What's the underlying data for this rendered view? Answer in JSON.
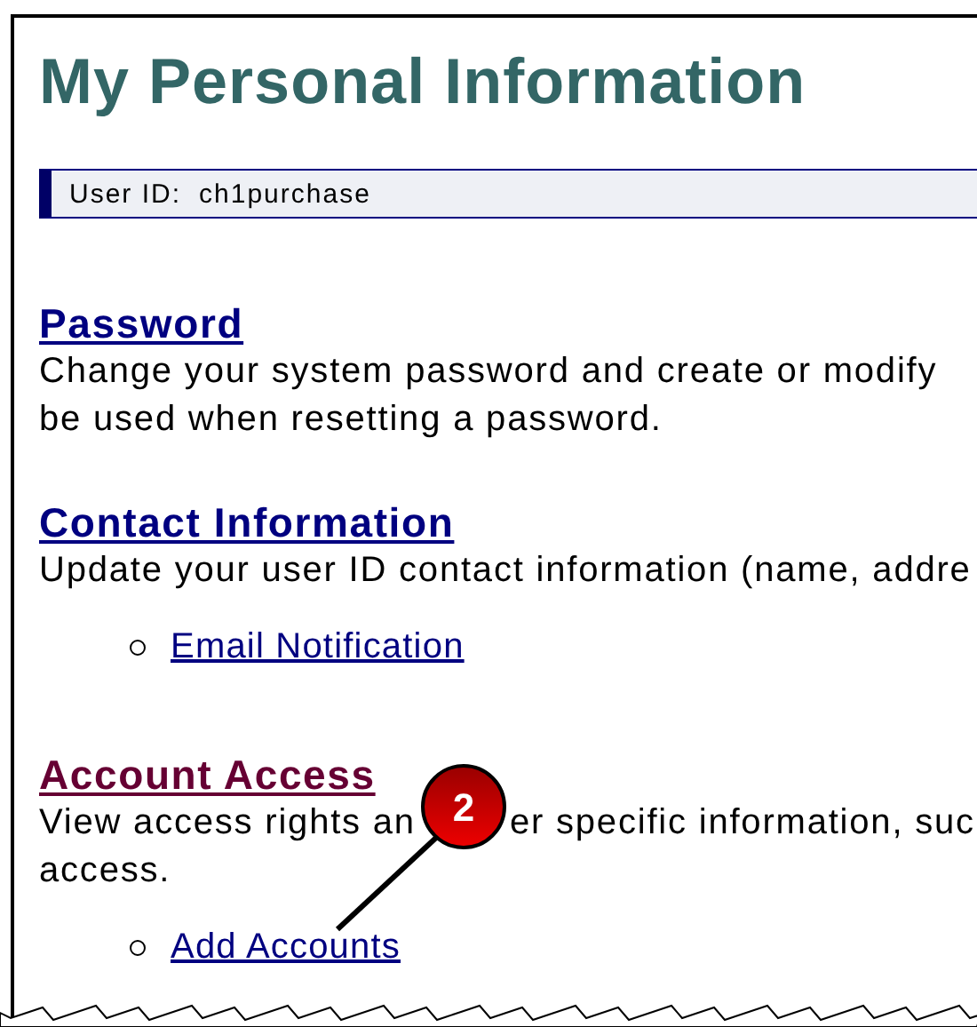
{
  "title": "My Personal Information",
  "user_id": {
    "label": "User ID:",
    "value": "ch1purchase"
  },
  "sections": [
    {
      "heading": "Password",
      "visited": false,
      "description": [
        [
          "Change your system password and create or modify"
        ],
        [
          "be used when resetting a password."
        ]
      ]
    },
    {
      "heading": "Contact Information",
      "visited": false,
      "description": [
        [
          "Update your user ID contact information (name, addre"
        ]
      ],
      "links": [
        "Email Notification"
      ]
    },
    {
      "heading": "Account Access",
      "visited": true,
      "description": [
        [
          "View access rights an",
          "er specific information, suc"
        ],
        [
          "access."
        ]
      ],
      "links": [
        "Add Accounts"
      ]
    }
  ],
  "callout": {
    "number": "2"
  }
}
